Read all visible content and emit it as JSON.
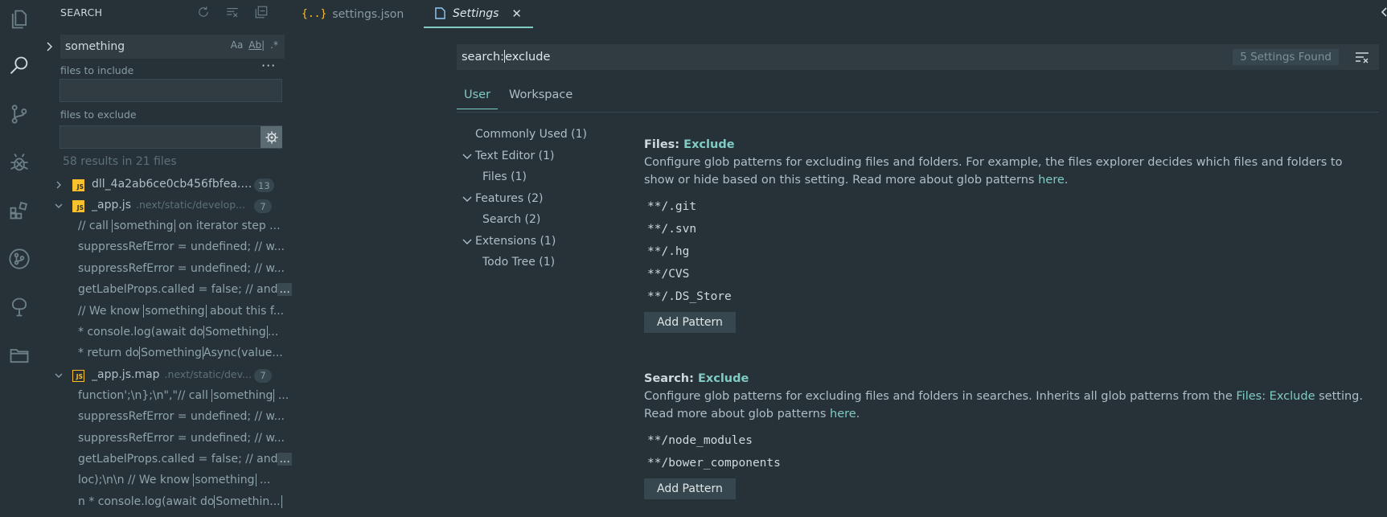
{
  "sidebar": {
    "title": "SEARCH",
    "query": "something",
    "options": [
      "Aa",
      "Ab|",
      ".*"
    ],
    "files_to_include_label": "files to include",
    "files_to_exclude_label": "files to exclude",
    "files_to_include_value": "",
    "files_to_exclude_value": "",
    "ellipsis": "···",
    "results_summary": "58 results in 21 files",
    "files": [
      {
        "name": "dll_4a2ab6ce0cb456fbfea...",
        "path": "",
        "count": "13",
        "expanded": false,
        "icon": "js-icon"
      },
      {
        "name": "_app.js",
        "path": ".next/static/develop...",
        "count": "7",
        "expanded": true,
        "icon": "js-icon",
        "matches": [
          {
            "pre": "// call ",
            "hl": "something",
            "post": " on iterator step ..."
          },
          {
            "pre": "suppressRefError = undefined; // w...",
            "hl": "",
            "post": ""
          },
          {
            "pre": "suppressRefError = undefined; // w...",
            "hl": "",
            "post": ""
          },
          {
            "pre": "getLabelProps.called = false; // and",
            "hl": "",
            "post": "",
            "ovf": "..."
          },
          {
            "pre": "// We know ",
            "hl": "something",
            "post": " about this f..."
          },
          {
            "pre": "*   console.log(await do",
            "hl": "Something",
            "post": "..."
          },
          {
            "pre": "*   return do",
            "hl": "Something",
            "post": "Async(value..."
          }
        ]
      },
      {
        "name": "_app.js.map",
        "path": ".next/static/dev...",
        "count": "7",
        "expanded": true,
        "icon": "js-map-icon",
        "matches": [
          {
            "pre": "function';\\n};\\n\",\"// call ",
            "hl": "something",
            "post": " ..."
          },
          {
            "pre": "suppressRefError = undefined; // w...",
            "hl": "",
            "post": ""
          },
          {
            "pre": "suppressRefError = undefined; // w...",
            "hl": "",
            "post": ""
          },
          {
            "pre": "getLabelProps.called = false; // and",
            "hl": "",
            "post": "",
            "ovf": "..."
          },
          {
            "pre": "loc);\\n\\n     // We know ",
            "hl": "something",
            "post": " ..."
          },
          {
            "pre": "n *   console.log(await do",
            "hl": "Somethin...",
            "post": ""
          }
        ]
      }
    ]
  },
  "tabs": [
    {
      "icon": "{..}",
      "label": "settings.json",
      "active": false
    },
    {
      "icon": "file-icon",
      "label": "Settings",
      "active": true
    }
  ],
  "settings": {
    "search_query_prefix": "search:",
    "search_query_rest": "exclude",
    "found_count": "5 Settings Found",
    "scopes": [
      "User",
      "Workspace"
    ],
    "toc": [
      {
        "label": "Commonly Used (1)",
        "caret": false,
        "indent": 0
      },
      {
        "label": "Text Editor (1)",
        "caret": true,
        "indent": 0
      },
      {
        "label": "Files (1)",
        "caret": false,
        "indent": 1
      },
      {
        "label": "Features (2)",
        "caret": true,
        "indent": 0
      },
      {
        "label": "Search (2)",
        "caret": false,
        "indent": 1
      },
      {
        "label": "Extensions (1)",
        "caret": true,
        "indent": 0
      },
      {
        "label": "Todo Tree (1)",
        "caret": false,
        "indent": 1
      }
    ],
    "items": [
      {
        "category": "Files: ",
        "key": "Exclude",
        "desc_pre": "Configure glob patterns for excluding files and folders. For example, the files explorer decides which files and folders to show or hide based on this setting. Read more about glob patterns ",
        "desc_link": "here",
        "desc_mid": "",
        "desc_link2": "",
        "desc_post": ".",
        "patterns": [
          "**/.git",
          "**/.svn",
          "**/.hg",
          "**/CVS",
          "**/.DS_Store"
        ],
        "button": "Add Pattern"
      },
      {
        "category": "Search: ",
        "key": "Exclude",
        "desc_pre": "Configure glob patterns for excluding files and folders in searches. Inherits all glob patterns from the ",
        "desc_link": "Files: Exclude",
        "desc_mid": " setting. Read more about glob patterns ",
        "desc_link2": "here",
        "desc_post": ".",
        "patterns": [
          "**/node_modules",
          "**/bower_components"
        ],
        "button": "Add Pattern"
      }
    ]
  },
  "colors": {
    "accent": "#80cbc4",
    "background": "#263238",
    "js_yellow": "#fbc02d"
  }
}
